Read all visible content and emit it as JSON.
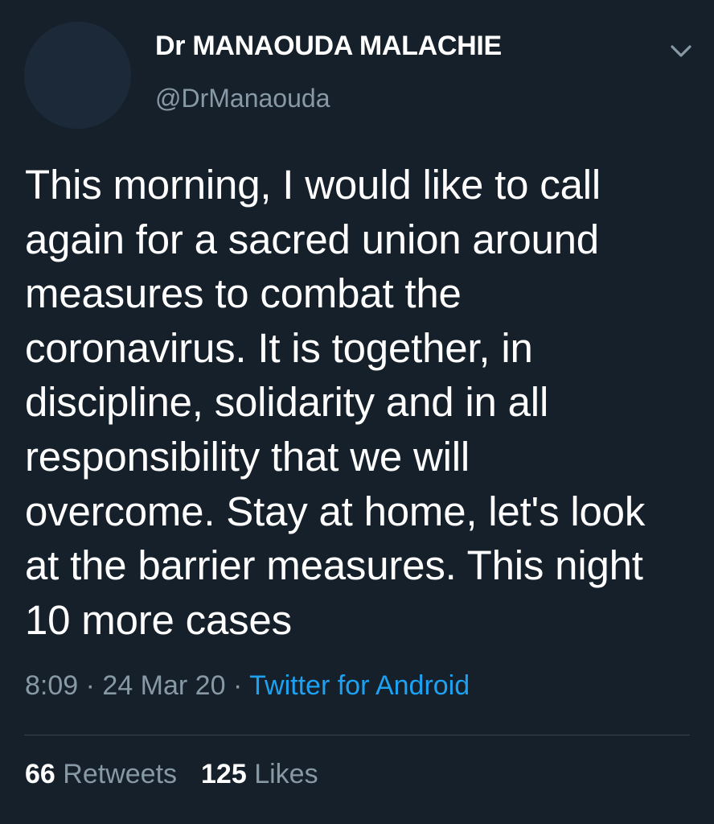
{
  "tweet": {
    "author": {
      "name": "Dr MANAOUDA MALACHIE",
      "handle": "@DrManaouda"
    },
    "text": "This morning, I would like to call\nagain for a sacred union around\nmeasures to combat the\ncoronavirus. It is together, in\ndiscipline, solidarity and in all\nresponsibility that we will\novercome. Stay at home, let's look\nat the barrier measures. This night\n10 more cases",
    "time": "8:09",
    "separator": "·",
    "date": "24 Mar 20",
    "source": "Twitter for Android",
    "stats": {
      "retweets_count": "66",
      "retweets_label": "Retweets",
      "likes_count": "125",
      "likes_label": "Likes"
    }
  },
  "icons": {
    "menu": "chevron-down-icon"
  },
  "colors": {
    "background": "#15202b",
    "text_primary": "#ffffff",
    "text_secondary": "#8899a6",
    "link": "#1da1f2",
    "divider": "#38444d"
  }
}
